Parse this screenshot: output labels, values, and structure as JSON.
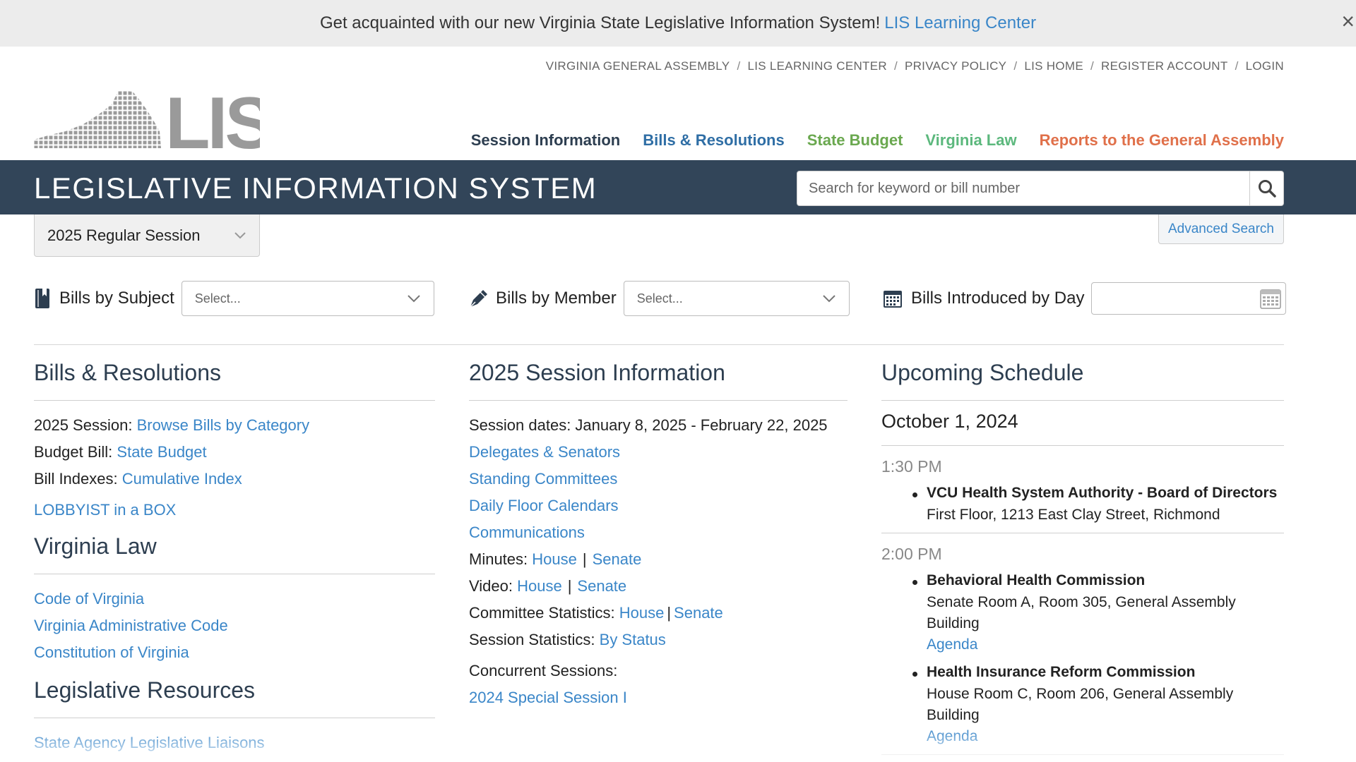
{
  "banner": {
    "text": "Get acquainted with our new Virginia State Legislative Information System!",
    "link": "LIS Learning Center",
    "close": "×"
  },
  "util_nav": [
    "VIRGINIA GENERAL ASSEMBLY",
    "LIS LEARNING CENTER",
    "PRIVACY POLICY",
    "LIS HOME",
    "REGISTER ACCOUNT",
    "LOGIN"
  ],
  "logo": {
    "text": "LIS"
  },
  "main_nav": {
    "session": "Session Information",
    "bills": "Bills & Resolutions",
    "budget": "State Budget",
    "law": "Virginia Law",
    "reports": "Reports to the General Assembly"
  },
  "titlebar": {
    "title": "LEGISLATIVE INFORMATION SYSTEM",
    "search_placeholder": "Search for keyword or bill number"
  },
  "session_select": "2025 Regular Session",
  "advanced_search": "Advanced Search",
  "filters": {
    "subject_label": "Bills by Subject",
    "subject_value": "Select...",
    "member_label": "Bills by Member",
    "member_value": "Select...",
    "day_label": "Bills Introduced by Day"
  },
  "col1": {
    "heading": "Bills & Resolutions",
    "session_label": "2025 Session:",
    "session_link": "Browse Bills by Category",
    "budget_label": "Budget Bill:",
    "budget_link": "State Budget",
    "index_label": "Bill Indexes:",
    "index_link": "Cumulative Index",
    "lobbyist": "LOBBYIST in a BOX",
    "law_heading": "Virginia Law",
    "law_links": [
      "Code of Virginia",
      "Virginia Administrative Code",
      "Constitution of Virginia"
    ],
    "resources_heading": "Legislative Resources",
    "resources_links": [
      "State Agency Legislative Liaisons"
    ]
  },
  "col2": {
    "heading": "2025 Session Information",
    "dates": "Session dates: January 8, 2025 - February 22, 2025",
    "links": [
      "Delegates & Senators",
      "Standing Committees",
      "Daily Floor Calendars",
      "Communications"
    ],
    "minutes_label": "Minutes:",
    "video_label": "Video:",
    "committee_label": "Committee Statistics:",
    "house": "House",
    "senate": "Senate",
    "stats_label": "Session Statistics:",
    "stats_link": "By Status",
    "concurrent_label": "Concurrent Sessions:",
    "concurrent_link": "2024 Special Session I"
  },
  "col3": {
    "heading": "Upcoming Schedule",
    "date": "October 1, 2024",
    "blocks": [
      {
        "time": "1:30 PM",
        "items": [
          {
            "name": "VCU Health System Authority - Board of Directors",
            "location": "First Floor, 1213 East Clay Street, Richmond"
          }
        ]
      },
      {
        "time": "2:00 PM",
        "items": [
          {
            "name": "Behavioral Health Commission",
            "location": "Senate Room A, Room 305, General Assembly Building",
            "agenda": "Agenda"
          },
          {
            "name": "Health Insurance Reform Commission",
            "location": "House Room C, Room 206, General Assembly Building",
            "agenda": "Agenda"
          }
        ]
      }
    ]
  },
  "colors": {
    "titlebar": "#324559",
    "link": "#3a86c8",
    "nav_session": "#2d3e50",
    "nav_bills": "#2f6ea5",
    "nav_budget": "#6aa84f",
    "nav_law": "#5cb87d",
    "nav_reports": "#e0704a"
  }
}
